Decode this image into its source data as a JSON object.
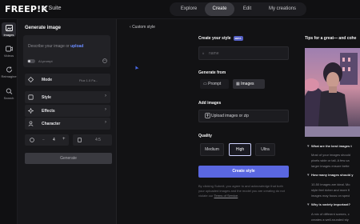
{
  "brand": {
    "logo": "FREEP!K",
    "suite": "AI Suite"
  },
  "topnav": [
    "Explore",
    "Create",
    "Edit",
    "My creations"
  ],
  "rail": [
    {
      "label": "Images",
      "icon": "image-icon"
    },
    {
      "label": "Videos",
      "icon": "video-icon"
    },
    {
      "label": "Reimagine",
      "icon": "refresh-icon"
    },
    {
      "label": "Search",
      "icon": "search-icon"
    }
  ],
  "panel": {
    "title": "Generate image",
    "prompt_placeholder": "Describe your image or ",
    "prompt_link": "upload",
    "ai_prompt_label": "AI-prompt",
    "mode_label": "Mode",
    "mode_value": "Flux 1.0 Fa...",
    "style_label": "Style",
    "effects_label": "Effects",
    "character_label": "Character",
    "count_value": "4",
    "count_minus": "−",
    "count_plus": "+",
    "ratio_value": "4:5",
    "generate_label": "Generate"
  },
  "main": {
    "back_label": "Custom style",
    "create_title": "Create your style",
    "beta": "BETA",
    "name_placeholder": "name",
    "generate_from_label": "Generate from",
    "gen_from_options": [
      "Prompt",
      "Images"
    ],
    "add_images_label": "Add images",
    "upload_label": "Upload images or zip",
    "quality_label": "Quality",
    "quality_options": [
      "Medium",
      "High",
      "Ultra"
    ],
    "create_button": "Create style",
    "terms_text": "By clicking Submit, you agree to and acknowledge that both your uploaded images and the model you are creating do not violate our ",
    "terms_link": "Terms of Service",
    "terms_end": "."
  },
  "tips": {
    "title": "Tips for a great— and cohe",
    "faq": [
      {
        "q": "What are the best images t",
        "a": [
          "Most of your images should",
          "pixels wide or tall. A few ca",
          "larger images ensure bette"
        ]
      },
      {
        "q": "How many images should y",
        "a": [
          "10-50 images are ideal. Mo",
          "style feel richer and more fl",
          "images may focus on speci"
        ]
      },
      {
        "q": "Why is variety important?",
        "a": [
          "A mix of different scenes, c",
          "creates a well-rounded sty"
        ]
      }
    ]
  },
  "colors": {
    "accent": "#5a67e0",
    "link": "#6b8cff",
    "beta": "#5661c6"
  }
}
